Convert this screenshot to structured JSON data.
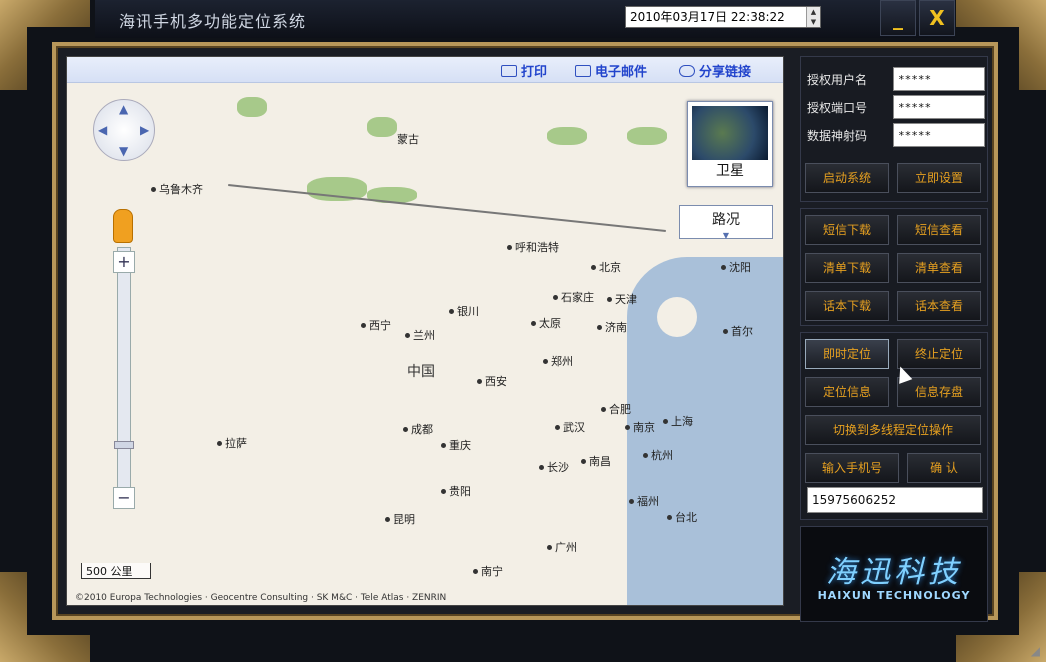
{
  "window": {
    "title": "海讯手机多功能定位系统",
    "datetime": "2010年03月17日 22:38:22",
    "minimize_label": "_",
    "close_label": "X"
  },
  "map": {
    "toolbar": {
      "print": "打印",
      "email": "电子邮件",
      "share": "分享链接"
    },
    "layers": {
      "satellite": "卫星",
      "terrain": "路况"
    },
    "zoom": {
      "in": "+",
      "out": "−"
    },
    "scale": "500 公里",
    "copyright": "©2010 Europa Technologies · Geocentre Consulting · SK M&C · Tele Atlas · ZENRIN",
    "labels": {
      "mongolia": "蒙古",
      "urumqi": "乌鲁木齐",
      "hohhot": "呼和浩特",
      "beijing": "北京",
      "tianjin": "天津",
      "shijiazhuang": "石家庄",
      "taiyuan": "太原",
      "jinan": "济南",
      "yinchuan": "银川",
      "xining": "西宁",
      "lanzhou": "兰州",
      "zhengzhou": "郑州",
      "china": "中国",
      "xian": "西安",
      "hefei": "合肥",
      "nanjing": "南京",
      "shanghai": "上海",
      "lhasa": "拉萨",
      "chengdu": "成都",
      "chongqing": "重庆",
      "wuhan": "武汉",
      "hangzhou": "杭州",
      "changsha": "长沙",
      "nanchang": "南昌",
      "guiyang": "贵阳",
      "fuzhou": "福州",
      "taipei": "台北",
      "kunming": "昆明",
      "guangzhou": "广州",
      "nanning": "南宁",
      "shenyang": "沈阳",
      "seoul": "首尔"
    }
  },
  "panel": {
    "auth": {
      "user_label": "授权用户名",
      "user_value": "*****",
      "port_label": "授权端口号",
      "port_value": "*****",
      "code_label": "数据神射码",
      "code_value": "*****"
    },
    "buttons": {
      "start": "启动系统",
      "settings": "立即设置",
      "sms_download": "短信下载",
      "sms_view": "短信查看",
      "list_download": "清单下载",
      "list_view": "清单查看",
      "contacts_download": "话本下载",
      "contacts_view": "话本查看",
      "realtime_locate": "即时定位",
      "stop_locate": "终止定位",
      "locate_info": "定位信息",
      "info_save": "信息存盘",
      "switch_mode": "切换到多线程定位操作",
      "enter_phone": "输入手机号",
      "confirm": "确 认"
    },
    "phone_value": "15975606252",
    "logo_cn": "海迅科技",
    "logo_en": "HAIXUN TECHNOLOGY"
  }
}
